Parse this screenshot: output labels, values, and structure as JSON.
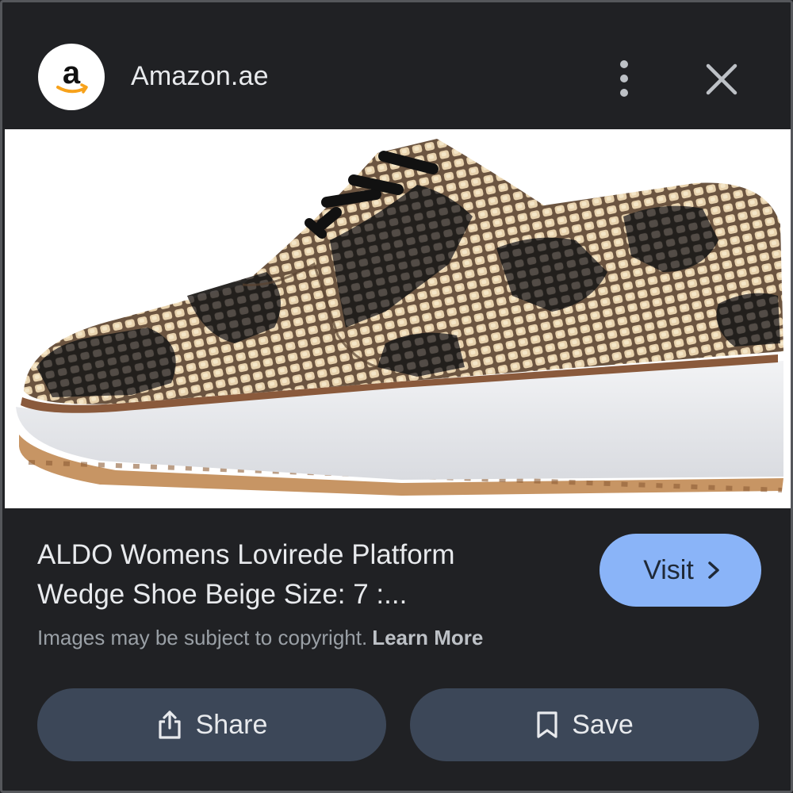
{
  "header": {
    "logo_icon": "amazon-logo",
    "site_name": "Amazon.ae",
    "more_icon": "more-vert-icon",
    "close_icon": "close-icon"
  },
  "image": {
    "alt": "ALDO Womens Lovirede Platform Wedge Shoe Beige"
  },
  "info": {
    "title": "ALDO Womens Lovirede Platform\nWedge Shoe Beige Size: 7 :...",
    "visit_label": "Visit",
    "copyright_text": "Images may be subject to copyright.",
    "learn_more_label": "Learn More"
  },
  "actions": {
    "share_label": "Share",
    "share_icon": "share-icon",
    "save_label": "Save",
    "save_icon": "bookmark-icon"
  },
  "colors": {
    "background": "#202124",
    "visit_button": "#8ab4f8",
    "action_button": "#3c4758",
    "text_primary": "#e8eaed",
    "text_secondary": "#9aa0a6"
  }
}
